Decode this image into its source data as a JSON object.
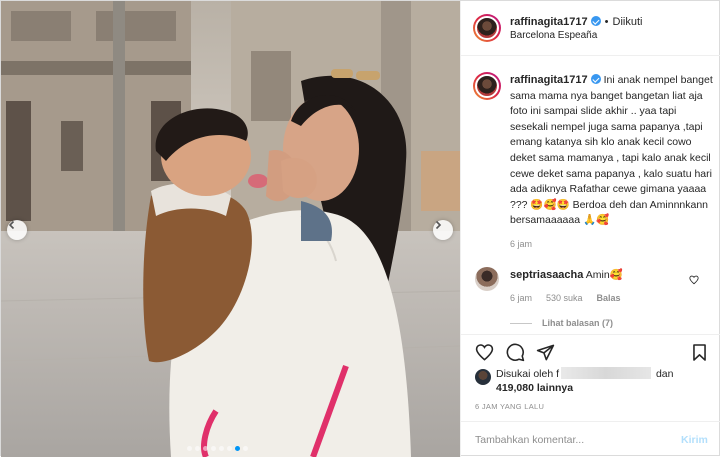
{
  "post": {
    "username": "raffinagita1717",
    "follow_state": "Diikuti",
    "separator": "•",
    "location": "Barcelona Espeaña"
  },
  "caption": {
    "username": "raffinagita1717",
    "text": "Ini anak nempel banget sama mama nya banget bangetan liat aja foto ini sampai slide akhir .. yaa tapi sesekali nempel juga sama papanya ,tapi emang katanya sih klo anak kecil cowo deket sama mamanya , tapi kalo anak kecil cewe deket sama papanya , kalo suatu hari ada adiknya Rafathar cewe gimana yaaaa ??? 🤩🥰🤩 Berdoa deh dan Aminnnkann bersamaaaaaa 🙏🥰",
    "time": "6 jam"
  },
  "comment": {
    "username": "septriasaacha",
    "text": "Amin🥰",
    "time": "6 jam",
    "likes": "530 suka",
    "reply_label": "Balas",
    "view_replies": "Lihat balasan (7)"
  },
  "likes": {
    "prefix": "Disukai oleh",
    "partial_name": "f",
    "conjunction": "dan",
    "count": "419,080",
    "suffix": "lainnya"
  },
  "date": "6 JAM YANG LALU",
  "add_comment": {
    "placeholder": "Tambahkan komentar...",
    "post_label": "Kirim"
  },
  "carousel": {
    "total_slides": 8,
    "active_index": 6
  },
  "colors": {
    "accent": "#0095f6",
    "verified": "#3897f0",
    "muted": "#8e8e8e"
  }
}
